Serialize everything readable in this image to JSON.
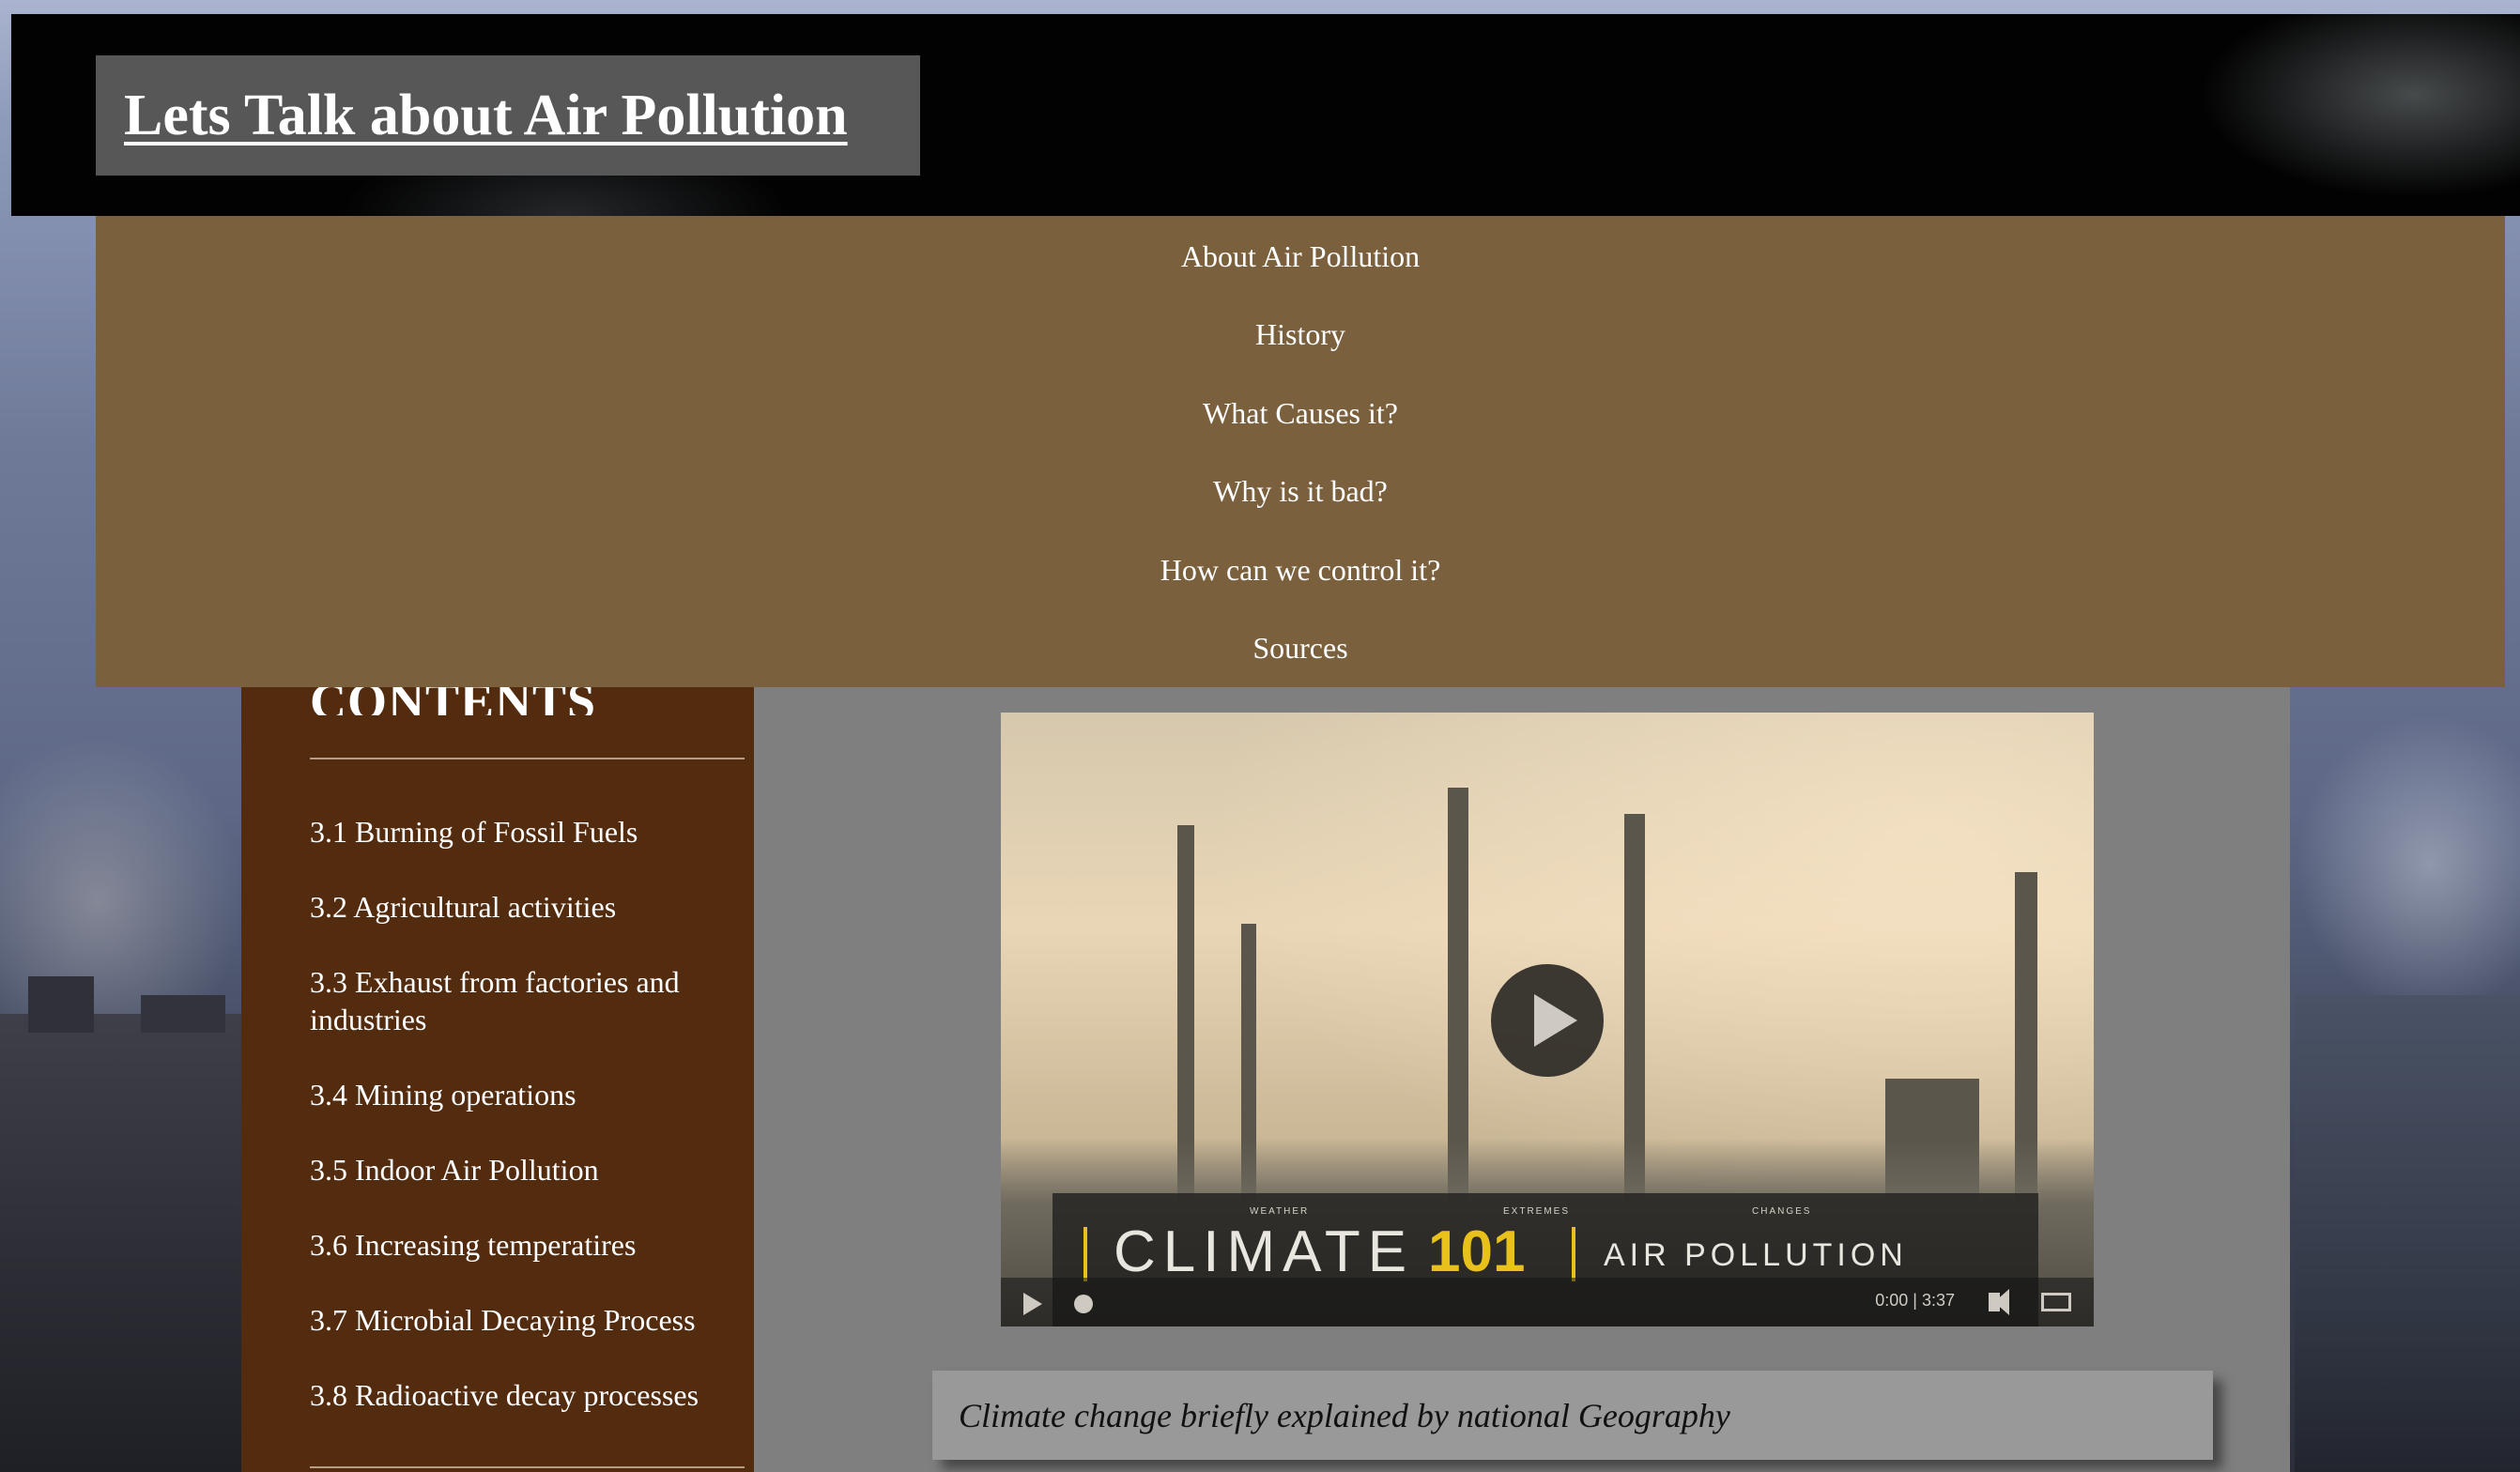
{
  "header": {
    "title": "Lets Talk about Air Pollution"
  },
  "nav": {
    "items": [
      "About Air Pollution",
      "History",
      "What Causes it?",
      "Why is it bad?",
      "How can we control it?",
      "Sources"
    ]
  },
  "sidebar": {
    "heading": "CONTENTS",
    "items": [
      "3.1 Burning of Fossil Fuels",
      "3.2 Agricultural activities",
      "3.3 Exhaust from factories and industries",
      "3.4 Mining operations",
      "3.5 Indoor Air Pollution",
      "3.6 Increasing temperatires",
      "3.7 Microbial Decaying Process",
      "3.8 Radioactive decay processes"
    ]
  },
  "video": {
    "banner_climate": "CLIMATE",
    "banner_number": "101",
    "banner_subtitle": "AIR POLLUTION",
    "banner_tags": [
      "WEATHER",
      "EXTREMES",
      "CHANGES"
    ],
    "time": "0:00 | 3:37",
    "progress": 0,
    "icons": {
      "play": "play-icon",
      "volume": "volume-icon",
      "captions": "captions-icon"
    }
  },
  "caption": "Climate change briefly explained by national Geography",
  "colors": {
    "header_bg": "#020202",
    "title_box_bg": "#575757",
    "nav_bg": "#7a603d",
    "sidebar_bg": "#532c10",
    "main_bg": "#7f7f7f",
    "caption_bg": "#999999",
    "accent_yellow": "#e8c21a"
  }
}
